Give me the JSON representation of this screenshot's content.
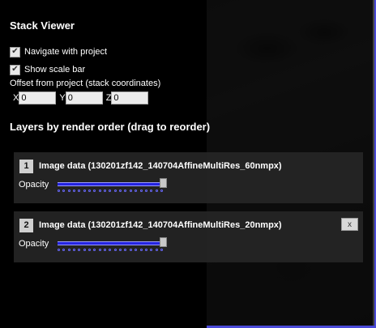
{
  "panel": {
    "title": "Stack Viewer",
    "navigate_with_project": {
      "label": "Navigate with project",
      "checked": true
    },
    "show_scale_bar": {
      "label": "Show scale bar",
      "checked": true
    },
    "offset": {
      "label": "Offset from project (stack coordinates)",
      "x_label": "X",
      "x_value": "0",
      "y_label": "Y",
      "y_value": "0",
      "z_label": "Z",
      "z_value": "0"
    },
    "layers_title": "Layers by render order (drag to reorder)",
    "layers": [
      {
        "index": "1",
        "name": "Image data (130201zf142_140704AffineMultiRes_60nmpx)",
        "opacity_label": "Opacity",
        "opacity": 1.0,
        "removable": false
      },
      {
        "index": "2",
        "name": "Image data (130201zf142_140704AffineMultiRes_20nmpx)",
        "opacity_label": "Opacity",
        "opacity": 1.0,
        "removable": true,
        "close_label": "x"
      }
    ]
  },
  "colors": {
    "slider_track": "#2323e0",
    "window_border": "#4a4ad8"
  }
}
